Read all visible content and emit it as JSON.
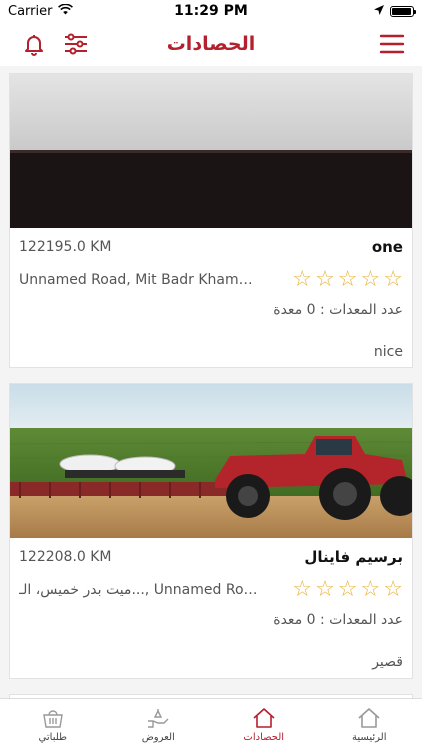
{
  "status_bar": {
    "carrier": "Carrier",
    "time": "11:29 PM",
    "battery_level": 0.95
  },
  "header": {
    "title": "الحصادات"
  },
  "colors": {
    "accent": "#b3202e",
    "star": "#e8b33c"
  },
  "cards": [
    {
      "name": "one",
      "distance": "122195.0 KM",
      "address": "Unnamed Road, Mit Badr Khamees, Al Mansoura...",
      "rating": 0,
      "equipment": "عدد المعدات : 0 معدة",
      "description": "nice"
    },
    {
      "name": "برسيم فاينال",
      "distance": "122208.0 KM",
      "address": "ميت بدر خميس، الـ..., Unnamed Road",
      "rating": 0,
      "equipment": "عدد المعدات : 0 معدة",
      "description": "قصير"
    }
  ],
  "tabs": [
    {
      "label": "الرئيسية",
      "icon": "home-icon",
      "active": false
    },
    {
      "label": "الحصادات",
      "icon": "harvester-home-icon",
      "active": true
    },
    {
      "label": "العروض",
      "icon": "offers-hand-icon",
      "active": false
    },
    {
      "label": "طلباتي",
      "icon": "basket-icon",
      "active": false
    }
  ]
}
